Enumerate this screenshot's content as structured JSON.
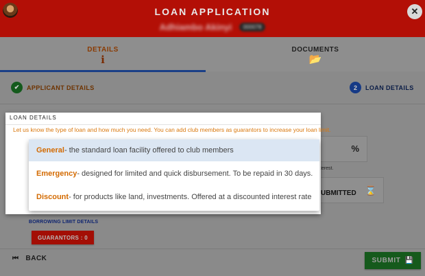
{
  "header": {
    "title": "LOAN APPLICATION",
    "member_name": "Adhiambo Akinyi",
    "member_id": "000078",
    "close_label": "✕"
  },
  "tabs": [
    {
      "label": "DETAILS",
      "icon": "info-icon",
      "glyph": "i",
      "active": true
    },
    {
      "label": "DOCUMENTS",
      "icon": "folder-open-icon",
      "glyph": "📂",
      "active": false
    }
  ],
  "stepper": [
    {
      "number": "✔",
      "label": "APPLICANT DETAILS",
      "state": "complete"
    },
    {
      "number": "2",
      "label": "LOAN DETAILS",
      "state": "current"
    }
  ],
  "loan_details": {
    "title": "LOAN DETAILS",
    "hint": "Let us know the type of loan and how much you need. You can add club members as guarantors to increase your loan limit.",
    "loan_type_options": [
      {
        "name": "General",
        "description": " - the standard loan facility offered to club members",
        "selected": true
      },
      {
        "name": "Emergency",
        "description": " - designed for limited and quick disbursement. To be repaid in 30 days.",
        "selected": false
      },
      {
        "name": "Discount",
        "description": " - for products like land, investments. Offered at a discounted interest rate",
        "selected": false
      }
    ]
  },
  "background_form": {
    "interest_icon": "%",
    "interest_hint": "terest.",
    "status_value": "UBMITTED",
    "status_icon": "⌛",
    "borrowing_limit_link": "BORROWING LIMIT DETAILS",
    "guarantors_label": "GUARANTORS : 0"
  },
  "footer": {
    "back_label": "BACK",
    "submit_label": "SUBMIT"
  },
  "colors": {
    "header_bg": "#b30f06",
    "accent_orange": "#d36a00",
    "success_green": "#155a1c",
    "primary_blue": "#1a3f87"
  }
}
